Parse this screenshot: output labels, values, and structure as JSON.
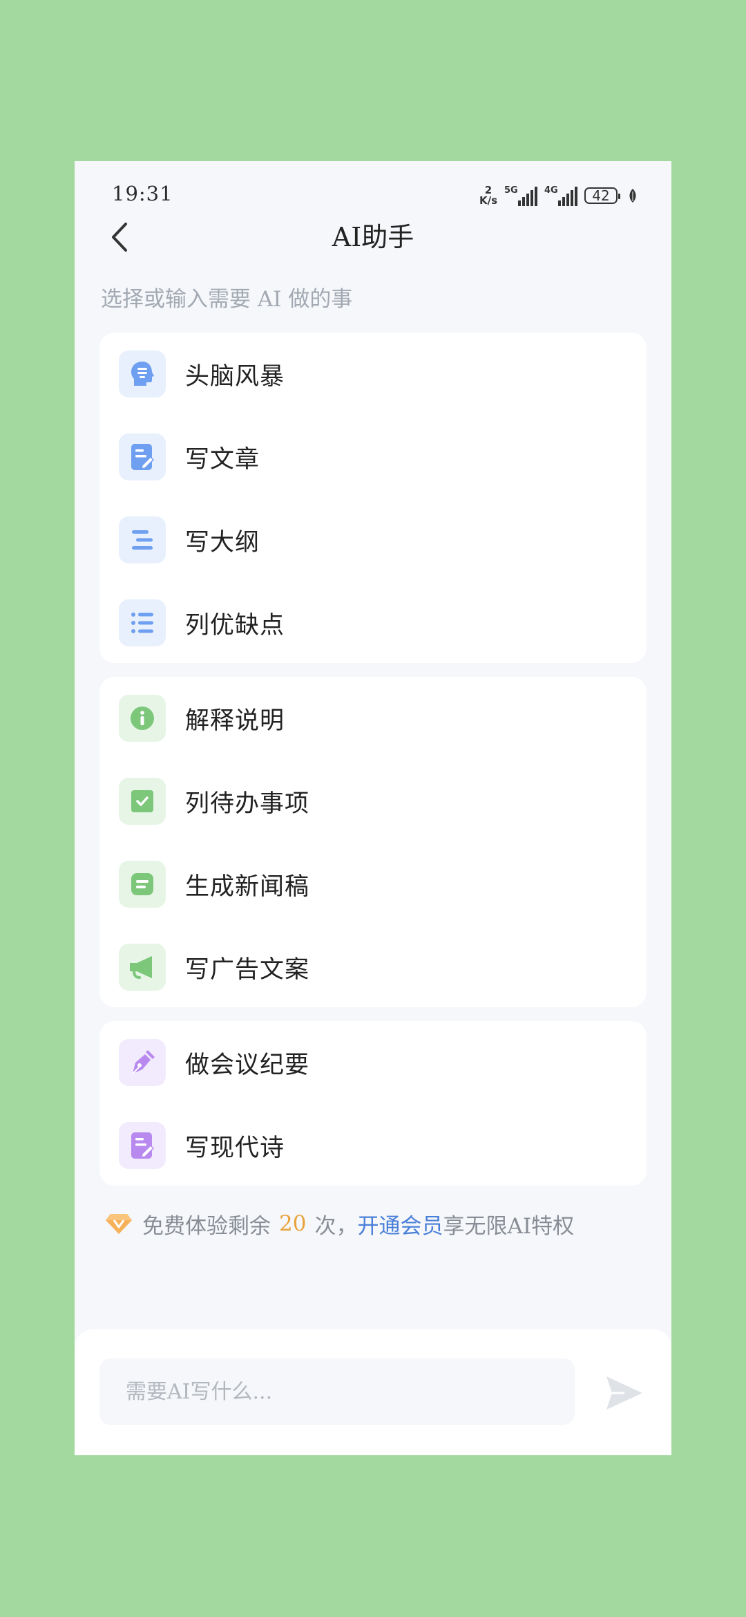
{
  "status_bar": {
    "time": "19:31",
    "net_speed_value": "2",
    "net_speed_unit": "K/s",
    "sim1_tag": "5G",
    "sim2_tag": "4G",
    "battery": "42"
  },
  "header": {
    "title": "AI助手"
  },
  "subtitle": "选择或输入需要 AI 做的事",
  "groups": [
    {
      "items": [
        {
          "label": "头脑风暴",
          "icon": "brain-head-icon"
        },
        {
          "label": "写文章",
          "icon": "write-article-icon"
        },
        {
          "label": "写大纲",
          "icon": "outline-icon"
        },
        {
          "label": "列优缺点",
          "icon": "bullet-list-icon"
        }
      ]
    },
    {
      "items": [
        {
          "label": "解释说明",
          "icon": "info-icon"
        },
        {
          "label": "列待办事项",
          "icon": "checkbox-icon"
        },
        {
          "label": "生成新闻稿",
          "icon": "news-doc-icon"
        },
        {
          "label": "写广告文案",
          "icon": "megaphone-icon"
        }
      ]
    },
    {
      "items": [
        {
          "label": "做会议纪要",
          "icon": "pen-nib-icon"
        },
        {
          "label": "写现代诗",
          "icon": "poem-doc-icon"
        }
      ]
    }
  ],
  "promo": {
    "prefix": "免费体验剩余",
    "count": "20",
    "suffix": "次，",
    "link": "开通会员",
    "tail": "享无限AI特权"
  },
  "input": {
    "placeholder": "需要AI写什么..."
  },
  "colors": {
    "background": "#a3d99e",
    "blue_accent": "#6f9ff0",
    "green_accent": "#7cc77a",
    "purple_accent": "#b889ee",
    "orange_count": "#e8a33c",
    "link": "#4a7fd8"
  }
}
